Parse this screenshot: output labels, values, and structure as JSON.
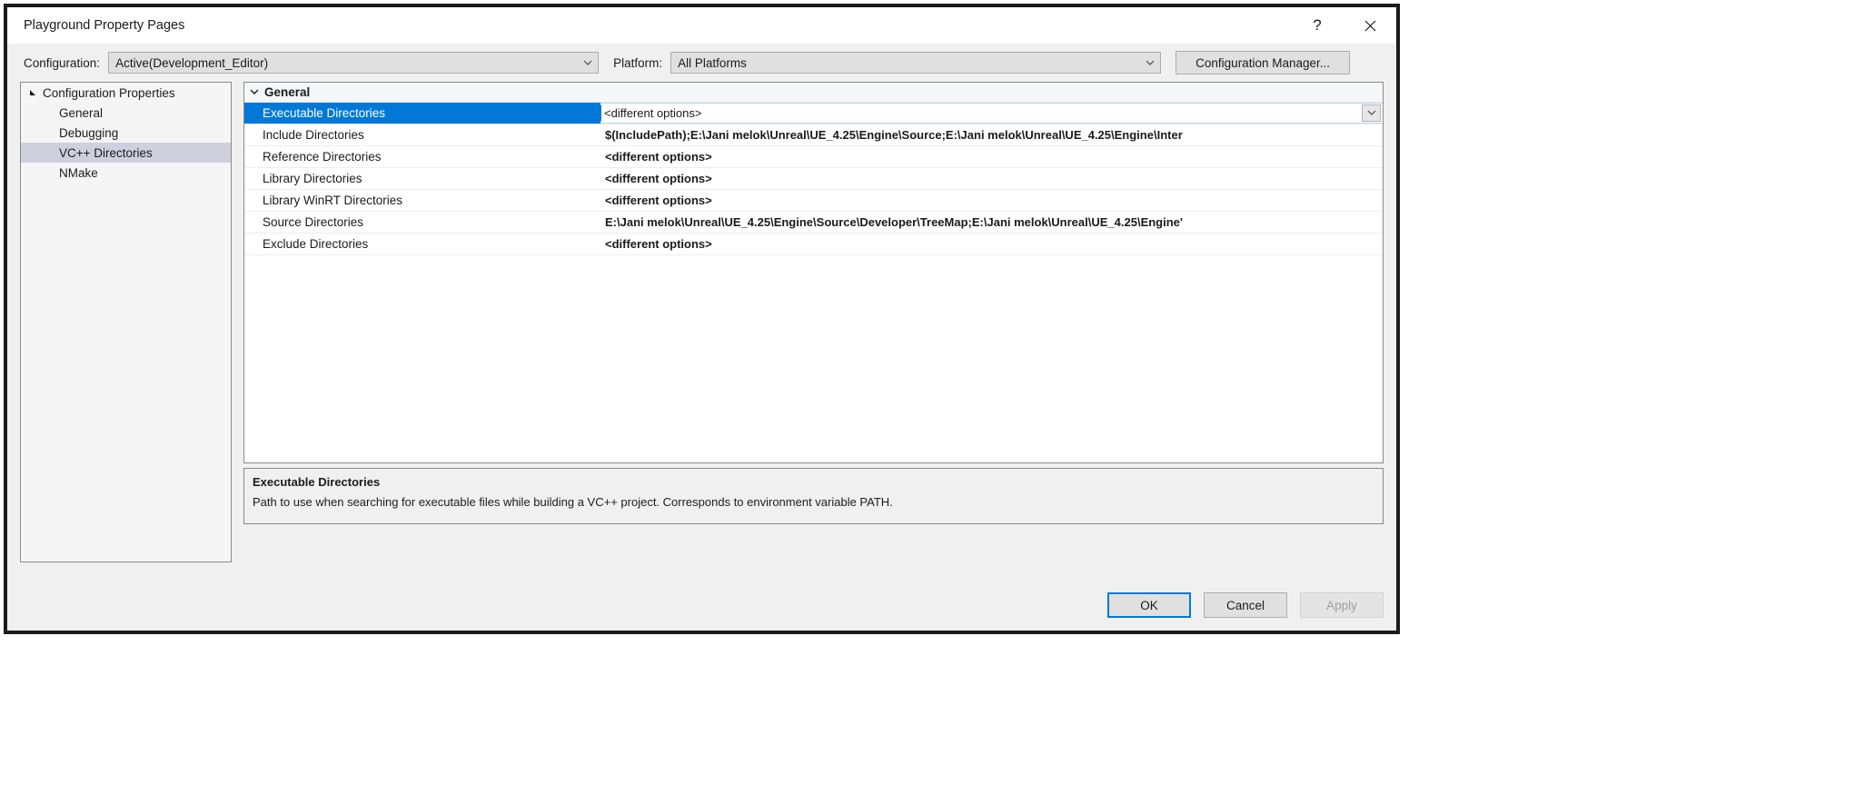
{
  "window": {
    "title": "Playground Property Pages",
    "help_button": "?",
    "close_button": "close-icon"
  },
  "config_bar": {
    "configuration_label": "Configuration:",
    "configuration_value": "Active(Development_Editor)",
    "platform_label": "Platform:",
    "platform_value": "All Platforms",
    "configuration_manager_button": "Configuration Manager..."
  },
  "tree": {
    "root": {
      "label": "Configuration Properties",
      "glyph": "expanded-triangle-icon"
    },
    "items": [
      {
        "label": "General",
        "selected": false
      },
      {
        "label": "Debugging",
        "selected": false
      },
      {
        "label": "VC++ Directories",
        "selected": true
      },
      {
        "label": "NMake",
        "selected": false
      }
    ]
  },
  "property_grid": {
    "group_title": "General",
    "group_chevron": "chevron-down-icon",
    "rows": [
      {
        "name": "Executable Directories",
        "value": "<different options>",
        "selected": true,
        "editing": true,
        "has_dropdown": true
      },
      {
        "name": "Include Directories",
        "value": "$(IncludePath);E:\\Jani melok\\Unreal\\UE_4.25\\Engine\\Source;E:\\Jani melok\\Unreal\\UE_4.25\\Engine\\Inter",
        "selected": false,
        "editing": false,
        "has_dropdown": false
      },
      {
        "name": "Reference Directories",
        "value": "<different options>",
        "selected": false,
        "editing": false,
        "has_dropdown": false
      },
      {
        "name": "Library Directories",
        "value": "<different options>",
        "selected": false,
        "editing": false,
        "has_dropdown": false
      },
      {
        "name": "Library WinRT Directories",
        "value": "<different options>",
        "selected": false,
        "editing": false,
        "has_dropdown": false
      },
      {
        "name": "Source Directories",
        "value": "E:\\Jani melok\\Unreal\\UE_4.25\\Engine\\Source\\Developer\\TreeMap;E:\\Jani melok\\Unreal\\UE_4.25\\Engine'",
        "selected": false,
        "editing": false,
        "has_dropdown": false
      },
      {
        "name": "Exclude Directories",
        "value": "<different options>",
        "selected": false,
        "editing": false,
        "has_dropdown": false
      }
    ]
  },
  "description": {
    "title": "Executable Directories",
    "text": "Path to use when searching for executable files while building a VC++ project.  Corresponds to environment variable PATH."
  },
  "footer": {
    "ok": "OK",
    "cancel": "Cancel",
    "apply": "Apply"
  },
  "colors": {
    "selection_blue": "#0078d7",
    "tree_selection": "#cfd0dd",
    "dialog_background": "#f0f0f0",
    "border_dark": "#1b1b1b"
  }
}
